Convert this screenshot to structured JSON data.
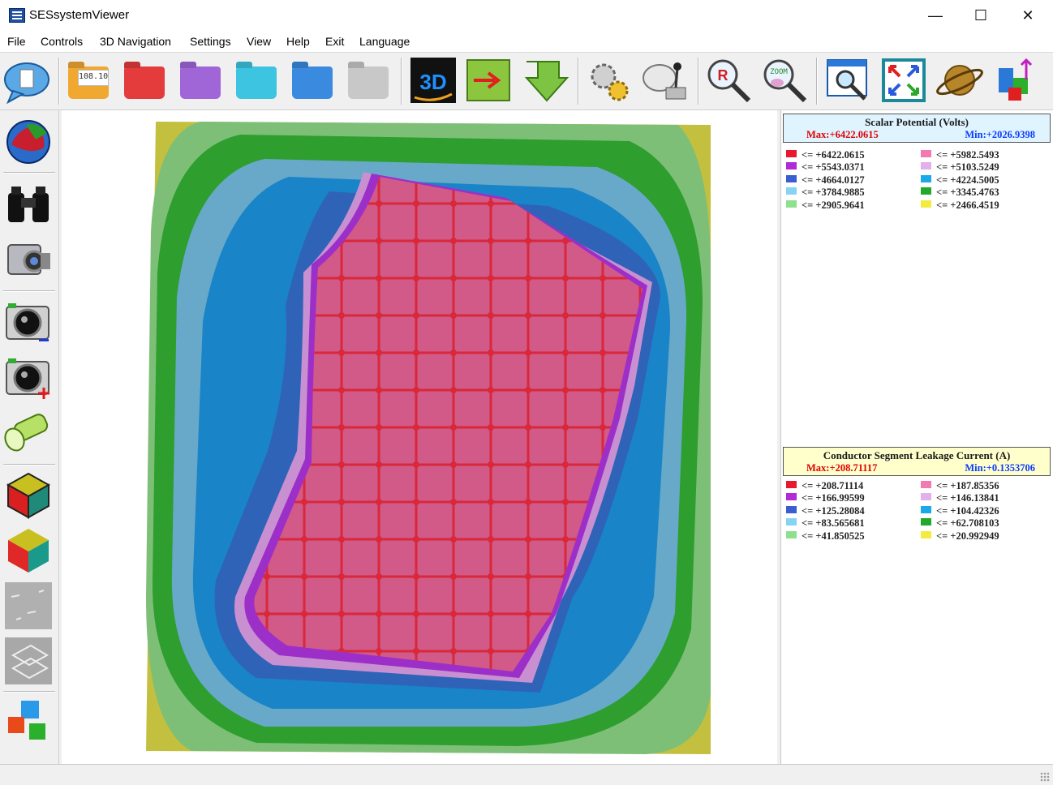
{
  "window": {
    "title": "SESsystemViewer",
    "minimize": "—",
    "maximize": "☐",
    "close": "✕"
  },
  "menu": [
    "File",
    "Controls",
    "3D Navigation",
    "Settings",
    "View",
    "Help",
    "Exit",
    "Language"
  ],
  "toolbar": {
    "folder_108_label": "108.10",
    "zoom_r_label": "R",
    "zoom_label": "ZOOM"
  },
  "legend_potential": {
    "title": "Scalar Potential (Volts)",
    "max": "Max:+6422.0615",
    "min": "Min:+2026.9398",
    "entries": [
      {
        "label": "<= +6422.0615",
        "color": "#e8192c"
      },
      {
        "label": "<= +5982.5493",
        "color": "#f27ab0"
      },
      {
        "label": "<= +5543.0371",
        "color": "#b02ad8"
      },
      {
        "label": "<= +5103.5249",
        "color": "#e2b0ea"
      },
      {
        "label": "<= +4664.0127",
        "color": "#3a5ed0"
      },
      {
        "label": "<= +4224.5005",
        "color": "#1aa8e8"
      },
      {
        "label": "<= +3784.9885",
        "color": "#86d4f2"
      },
      {
        "label": "<= +3345.4763",
        "color": "#22a82a"
      },
      {
        "label": "<= +2905.9641",
        "color": "#8ee08e"
      },
      {
        "label": "<= +2466.4519",
        "color": "#f2ec40"
      }
    ]
  },
  "legend_current": {
    "title": "Conductor Segment Leakage Current (A)",
    "max": "Max:+208.71117",
    "min": "Min:+0.1353706",
    "entries": [
      {
        "label": "<= +208.71114",
        "color": "#e8192c"
      },
      {
        "label": "<= +187.85356",
        "color": "#f27ab0"
      },
      {
        "label": "<= +166.99599",
        "color": "#b02ad8"
      },
      {
        "label": "<= +146.13841",
        "color": "#e2b0ea"
      },
      {
        "label": "<= +125.28084",
        "color": "#3a5ed0"
      },
      {
        "label": "<= +104.42326",
        "color": "#1aa8e8"
      },
      {
        "label": "<= +83.565681",
        "color": "#86d4f2"
      },
      {
        "label": "<= +62.708103",
        "color": "#22a82a"
      },
      {
        "label": "<= +41.850525",
        "color": "#8ee08e"
      },
      {
        "label": "<= +20.992949",
        "color": "#f2ec40"
      }
    ]
  },
  "plot_colors": {
    "corner": "#c3bf3f",
    "light_green": "#7dbf77",
    "green": "#2e9e2e",
    "light_blue": "#68a9c9",
    "blue": "#1a84c8",
    "dark_blue": "#2f63b8",
    "lavender": "#c890d0",
    "purple": "#9d2fc9",
    "pink": "#d25a88",
    "red": "#d8283a"
  }
}
